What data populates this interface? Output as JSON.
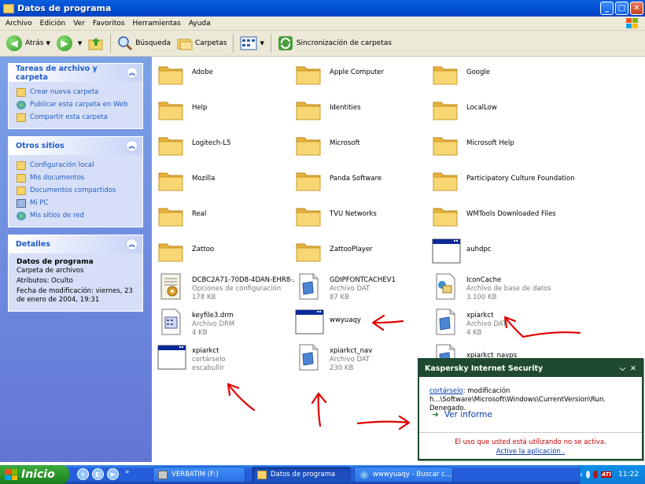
{
  "window": {
    "title": "Datos de programa"
  },
  "menu": [
    "Archivo",
    "Edición",
    "Ver",
    "Favoritos",
    "Herramientas",
    "Ayuda"
  ],
  "toolbar": {
    "back": "Atrás",
    "search": "Búsqueda",
    "folders": "Carpetas",
    "sync": "Sincronización de carpetas"
  },
  "tasks": {
    "title": "Tareas de archivo y carpeta",
    "items": [
      "Crear nueva carpeta",
      "Publicar esta carpeta en Web",
      "Compartir esta carpeta"
    ]
  },
  "places": {
    "title": "Otros sitios",
    "items": [
      "Configuración local",
      "Mis documentos",
      "Documentos compartidos",
      "Mi PC",
      "Mis sitios de red"
    ]
  },
  "details": {
    "title": "Detalles",
    "name": "Datos de programa",
    "type": "Carpeta de archivos",
    "attrs": "Atributos: Oculto",
    "modified": "Fecha de modificación: viernes, 23 de enero de 2004, 19:31"
  },
  "folders": [
    "Adobe",
    "Apple Computer",
    "Google",
    "Help",
    "Identities",
    "LocalLow",
    "Logitech-L5",
    "Microsoft",
    "Microsoft Help",
    "Mozilla",
    "Panda Software",
    "Participatory Culture Foundation",
    "Real",
    "TVU Networks",
    "WMTools Downloaded Files",
    "Zattoo",
    "ZattooPlayer"
  ],
  "files": [
    {
      "name": "auhdpc",
      "kind": "window",
      "line1": "",
      "line2": ""
    },
    {
      "name": "DCBC2A71-70D8-4DAN-EHR8-...",
      "kind": "config",
      "line1": "Opciones de configuración",
      "line2": "178 KB"
    },
    {
      "name": "GDIPFONTCACHEV1",
      "kind": "doc",
      "line1": "Archivo DAT",
      "line2": "87 KB"
    },
    {
      "name": "IconCache",
      "kind": "db",
      "line1": "Archivo de base de datos",
      "line2": "3.100 KB"
    },
    {
      "name": "keyfile3.drm",
      "kind": "drm",
      "line1": "Archivo DRM",
      "line2": "4 KB"
    },
    {
      "name": "wwyuaqy",
      "kind": "window",
      "line1": "",
      "line2": ""
    },
    {
      "name": "xpiarkct",
      "kind": "doc",
      "line1": "Archivo DAT",
      "line2": "4 KB"
    },
    {
      "name": "xpiarkct",
      "kind": "window",
      "line1": "cortárselo",
      "line2": "escabullir"
    },
    {
      "name": "xpiarkct_nav",
      "kind": "doc",
      "line1": "Archivo DAT",
      "line2": "230 KB"
    },
    {
      "name": "xpiarkct_navps",
      "kind": "doc",
      "line1": "",
      "line2": ""
    }
  ],
  "kaspersky": {
    "title": "Kaspersky Internet Security",
    "user": "cortárselo",
    "message": ": modificación h...\\Software\\Microsoft\\Windows\\CurrentVersion\\Run. Denegado.",
    "link": "Ver informe",
    "warning": "El uso que usted está utilizando no se activa.",
    "activate": "Active la aplicación ."
  },
  "taskbar": {
    "start": "Inicio",
    "items": [
      "VERBATIM (F:)",
      "Datos de programa",
      "wwwyuaqy - Buscar c..."
    ],
    "clock": "11:22",
    "ati": "ATI"
  },
  "colors": {
    "title_blue": "#0052d6",
    "panel_blue": "#7ba2e7",
    "kaspersky_green": "#1f4a30",
    "annotation_red": "#e00000"
  }
}
